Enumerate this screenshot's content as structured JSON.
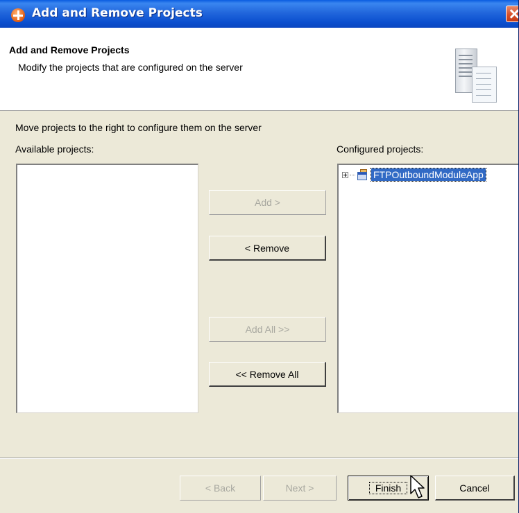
{
  "window": {
    "title": "Add and Remove Projects"
  },
  "header": {
    "title": "Add and Remove Projects",
    "description": "Modify the projects that are configured on the server"
  },
  "instruction": "Move projects to the right to configure them on the server",
  "available": {
    "label": "Available projects:",
    "items": []
  },
  "configured": {
    "label": "Configured projects:",
    "items": [
      {
        "label": "FTPOutboundModuleApp",
        "selected": true,
        "expandable": true
      }
    ]
  },
  "actions": {
    "add": "Add >",
    "remove": "< Remove",
    "add_all": "Add All >>",
    "remove_all": "<< Remove All"
  },
  "footer": {
    "back": "< Back",
    "next": "Next >",
    "finish": "Finish",
    "cancel": "Cancel"
  },
  "colors": {
    "titlebar": "#0a4fcf",
    "selection": "#316ac5",
    "dialog_bg": "#ece9d8"
  }
}
